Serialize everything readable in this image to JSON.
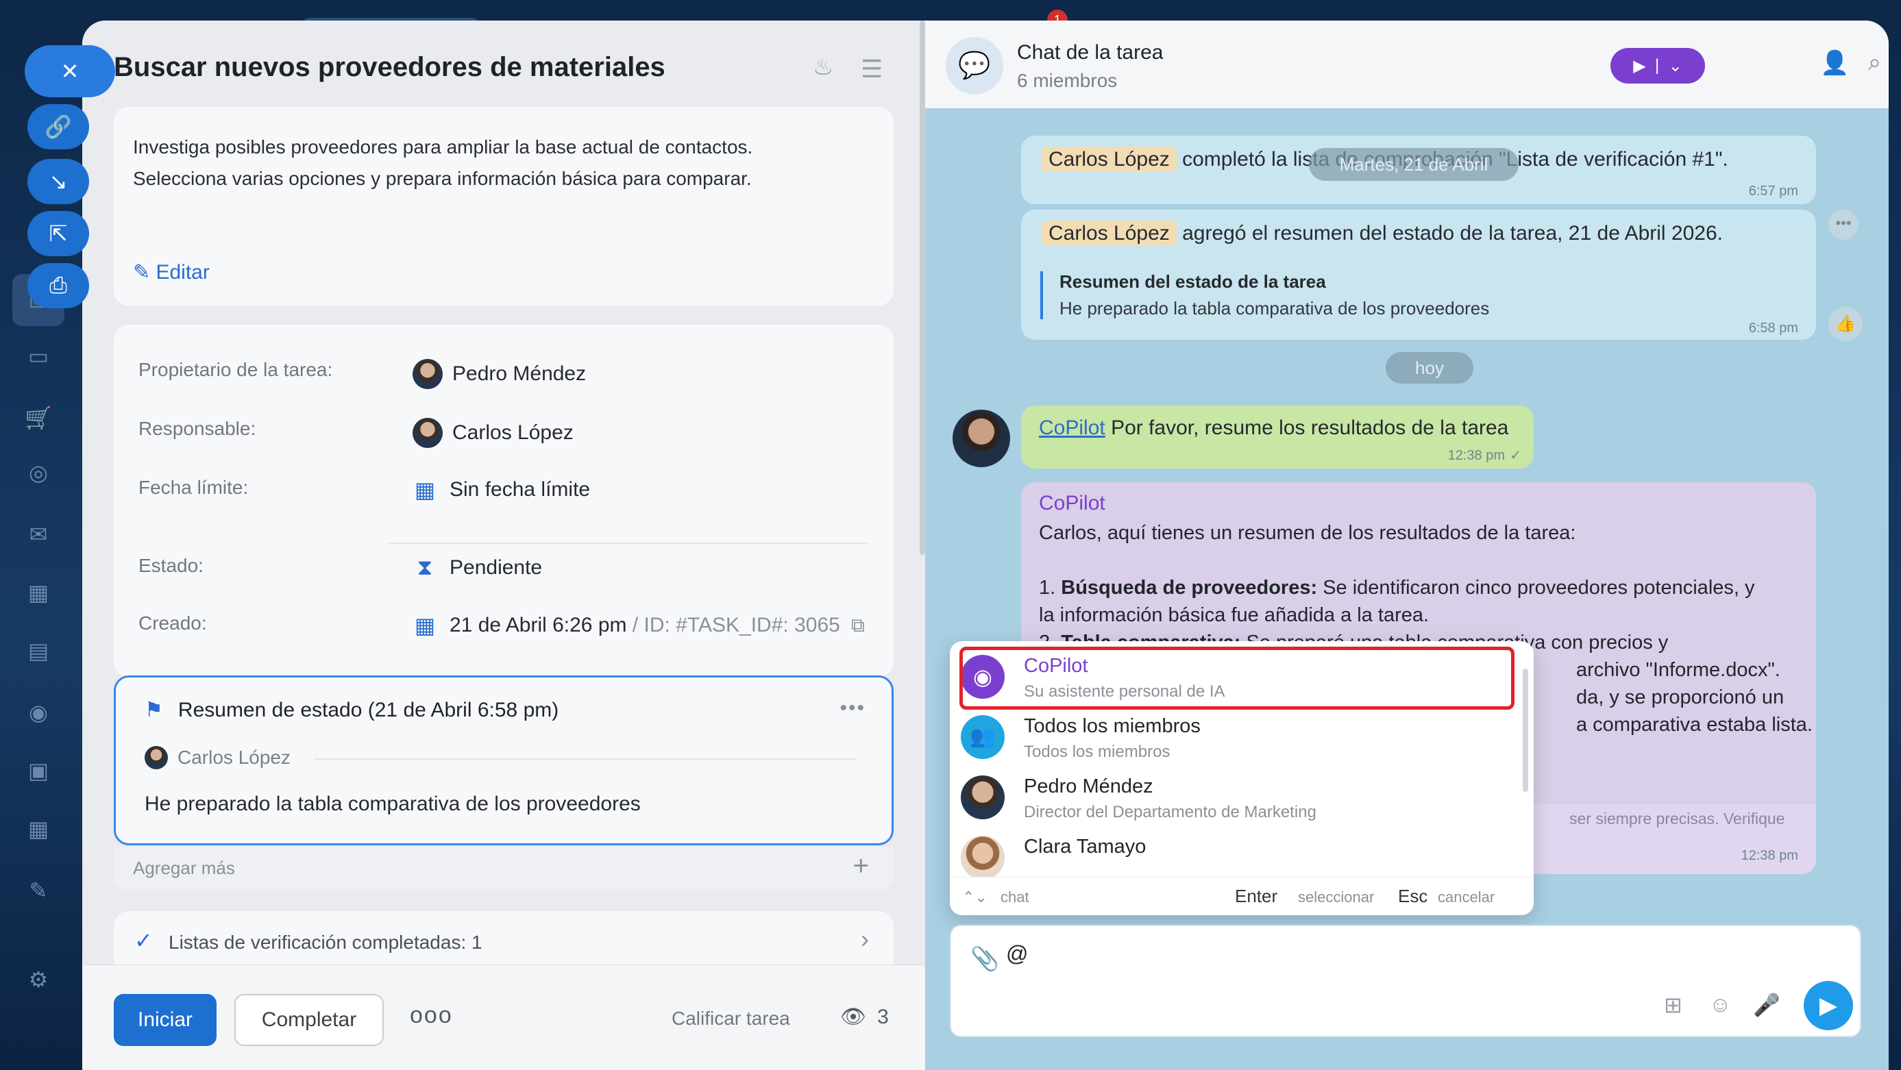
{
  "task": {
    "title": "Buscar nuevos proveedores de materiales",
    "description_line1": "Investiga posibles proveedores para ampliar la base actual de contactos.",
    "description_line2": "Selecciona varias opciones y prepara información básica para comparar.",
    "edit_label": "Editar",
    "owner_label": "Propietario de la tarea:",
    "owner_value": "Pedro Méndez",
    "responsible_label": "Responsable:",
    "responsible_value": "Carlos López",
    "deadline_label": "Fecha límite:",
    "deadline_value": "Sin fecha límite",
    "status_label": "Estado:",
    "status_value": "Pendiente",
    "created_label": "Creado:",
    "created_value": "21 de Abril 6:26 pm",
    "id_sep": "/",
    "id_value": "ID: #TASK_ID#: 3065",
    "summary_title": "Resumen de estado (21 de Abril 6:58 pm)",
    "summary_author": "Carlos López",
    "summary_text": "He preparado la tabla comparativa de los proveedores",
    "add_more": "Agregar más",
    "checklists": "Listas de verificación completadas: 1",
    "start_button": "Iniciar",
    "complete_button": "Completar",
    "rate_label": "Calificar tarea",
    "watchers_count": "3"
  },
  "chat": {
    "title": "Chat de la tarea",
    "members": "6 miembros",
    "msg1_name": "Carlos López",
    "msg1_text": "completó la lista de comprobación \"Lista de verificación #1\".",
    "msg1_time": "6:57 pm",
    "date_pill": "Martes, 21 de Abril",
    "msg2_name": "Carlos López",
    "msg2_text": "agregó el resumen del estado de la tarea, 21 de Abril 2026.",
    "msg2_quote_title": "Resumen del estado de la tarea",
    "msg2_quote_text": "He preparado la tabla comparativa de los proveedores",
    "msg2_time": "6:58 pm",
    "today_pill": "hoy",
    "out_mention": "CoPilot",
    "out_text": "Por favor, resume los resultados de la tarea",
    "out_time": "12:38 pm",
    "bot_name": "CoPilot",
    "bot_intro": "Carlos, aquí tienes un resumen de los resultados de la tarea:",
    "bot_p1_num": "1.",
    "bot_p1_bold": "Búsqueda de proveedores:",
    "bot_p1_text": "Se identificaron cinco proveedores potenciales, y",
    "bot_p1_cont": "la información básica fue añadida a la tarea.",
    "bot_p2_num": "2.",
    "bot_p2_bold": "Tabla comparativa:",
    "bot_p2_text": "Se preparó una tabla comparativa con precios y",
    "bot_p2_tail": "archivo \"Informe.docx\".",
    "bot_p3_tail": "da, y se proporcionó un",
    "bot_p4_tail": "a comparativa estaba lista.",
    "bot_disclaimer_tail": "ser siempre precisas. Verifique",
    "bot_time": "12:38 pm",
    "composer_value": "@"
  },
  "mention": {
    "items": [
      {
        "name": "CoPilot",
        "sub": "Su asistente personal de IA"
      },
      {
        "name": "Todos los miembros",
        "sub": "Todos los miembros"
      },
      {
        "name": "Pedro Méndez",
        "sub": "Director del Departamento de Marketing"
      },
      {
        "name": "Clara Tamayo",
        "sub": ""
      }
    ],
    "footer_nav_hint": "chat",
    "footer_enter_key": "Enter",
    "footer_enter_hint": "seleccionar",
    "footer_esc_key": "Esc",
    "footer_esc_hint": "cancelar"
  },
  "colors": {
    "accent": "#1d6fd0",
    "copilot_purple": "#7b3fd0",
    "highlight_red": "#e0232b",
    "chat_bg": "#a8cfe2"
  }
}
